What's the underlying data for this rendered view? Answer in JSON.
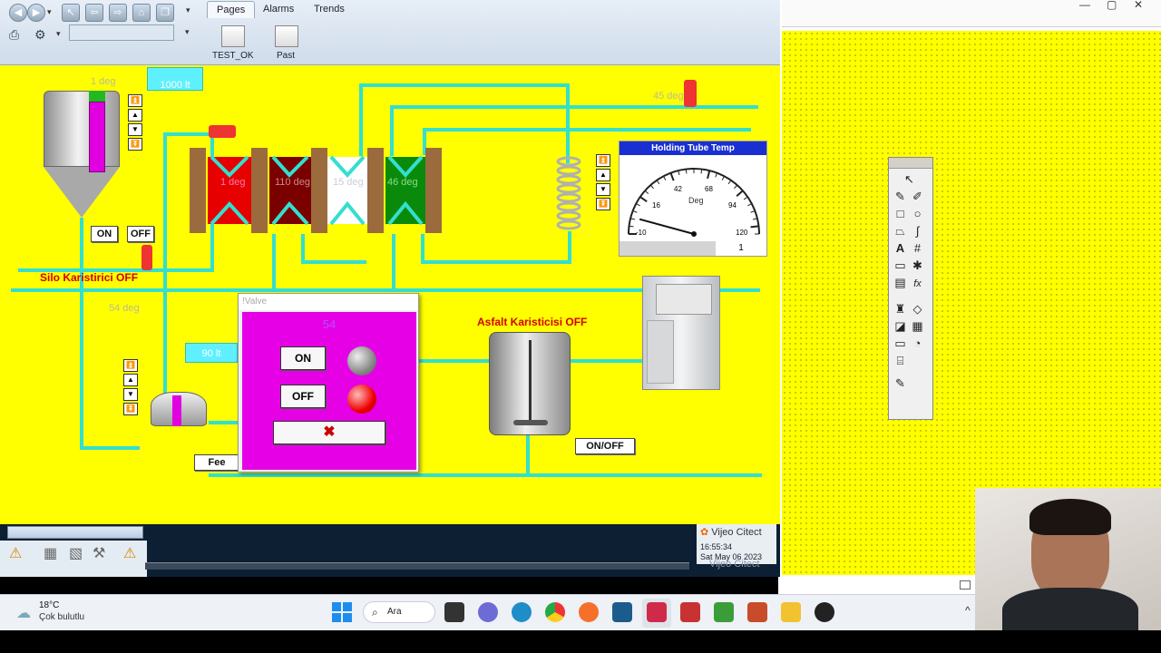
{
  "app": {
    "tabs": [
      "Pages",
      "Alarms",
      "Trends"
    ],
    "pages": [
      "TEST_OK",
      "Past"
    ]
  },
  "process": {
    "silo_temp": "1 deg",
    "silo_level": "1000 lt",
    "hx_temps": [
      "1 deg",
      "110 deg",
      "15 deg",
      "46 deg"
    ],
    "top_right_temp": "45 deg",
    "silo_on": "ON",
    "silo_off": "OFF",
    "silo_mixer_status": "Silo Karistirici OFF",
    "lower_temp": "54 deg",
    "lower_level": "90 lt",
    "feed_button": "Fee",
    "asphalt_mixer_status": "Asfalt Karisticisi OFF",
    "onoff_button": "ON/OFF"
  },
  "gauge": {
    "title": "Holding Tube Temp",
    "unit": "Deg",
    "ticks": [
      "-10",
      "16",
      "42",
      "68",
      "94",
      "120"
    ],
    "readout": "1",
    "value": 1
  },
  "dialog": {
    "title": "!Valve",
    "value": "54",
    "on_label": "ON",
    "off_label": "OFF",
    "close_symbol": "✖"
  },
  "footer": {
    "brand": "Vijeo Citect",
    "time": "16:55:34",
    "date": "Sat May 06 2023",
    "brand_shadow": "Vijeo Citect"
  },
  "taskbar": {
    "temperature": "18°C",
    "weather": "Çok bulutlu",
    "search_label": "Ara"
  },
  "colors": {
    "canvas": "#ffff00",
    "pipe": "#33dfcf",
    "dialog_bg": "#e600e6",
    "alarm_red": "#d40000",
    "gauge_header": "#1a2fd1"
  }
}
